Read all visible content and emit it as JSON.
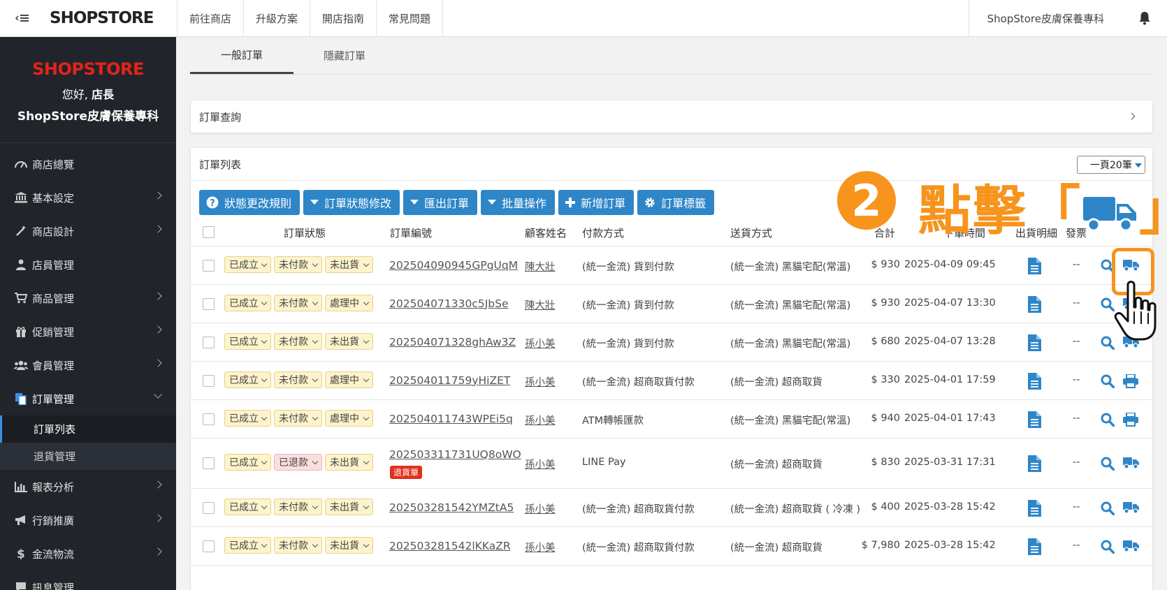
{
  "topbar": {
    "toggle_label": "‹ ≡",
    "logo": "SHOPSTORE",
    "nav": [
      "前往商店",
      "升級方案",
      "開店指南",
      "常見問題"
    ],
    "shop_name": "ShopStore皮膚保養專科"
  },
  "sidebar": {
    "logo": "SHOPSTORE",
    "greeting_prefix": "您好,",
    "greeting_role": "店長",
    "shop_name": "ShopStore皮膚保養專科",
    "items": [
      {
        "label": "商店總覽"
      },
      {
        "label": "基本設定"
      },
      {
        "label": "商店設計"
      },
      {
        "label": "店員管理"
      },
      {
        "label": "商品管理"
      },
      {
        "label": "促銷管理"
      },
      {
        "label": "會員管理"
      },
      {
        "label": "訂單管理"
      },
      {
        "label": "報表分析"
      },
      {
        "label": "行銷推廣"
      },
      {
        "label": "金流物流"
      },
      {
        "label": "訊息管理"
      }
    ],
    "sub_items": [
      "訂單列表",
      "退貨管理"
    ]
  },
  "tabs": [
    "一般訂單",
    "隱藏訂單"
  ],
  "query_panel": {
    "title": "訂單查詢"
  },
  "list_panel": {
    "title": "訂單列表",
    "per_page": "一頁20筆",
    "buttons": [
      "狀態更改規則",
      "訂單狀態修改",
      "匯出訂單",
      "批量操作",
      "新增訂單",
      "訂單標籤"
    ],
    "headers": [
      "訂單狀態",
      "訂單編號",
      "顧客姓名",
      "付款方式",
      "送貨方式",
      "合計",
      "下單時間",
      "出貨明細",
      "發票"
    ]
  },
  "orders": [
    {
      "status": [
        "已成立",
        "未付款",
        "未出貨"
      ],
      "order_no": "202504090945GPgUqM",
      "return_badge": "",
      "customer": "陳大壯",
      "payment": "(統一金流) 貨到付款",
      "shipping": "(統一金流) 黑貓宅配(常溫)",
      "total": "$ 930",
      "time": "2025-04-09 09:45",
      "invoice": "--",
      "action": "truck"
    },
    {
      "status": [
        "已成立",
        "未付款",
        "處理中"
      ],
      "order_no": "202504071330c5JbSe",
      "return_badge": "",
      "customer": "陳大壯",
      "payment": "(統一金流) 貨到付款",
      "shipping": "(統一金流) 黑貓宅配(常溫)",
      "total": "$ 930",
      "time": "2025-04-07 13:30",
      "invoice": "--",
      "action": "truck"
    },
    {
      "status": [
        "已成立",
        "未付款",
        "未出貨"
      ],
      "order_no": "202504071328ghAw3Z",
      "return_badge": "",
      "customer": "孫小美",
      "payment": "(統一金流) 貨到付款",
      "shipping": "(統一金流) 黑貓宅配(常溫)",
      "total": "$ 680",
      "time": "2025-04-07 13:28",
      "invoice": "--",
      "action": "truck"
    },
    {
      "status": [
        "已成立",
        "未付款",
        "處理中"
      ],
      "order_no": "202504011759yHiZET",
      "return_badge": "",
      "customer": "孫小美",
      "payment": "(統一金流) 超商取貨付款",
      "shipping": "(統一金流) 超商取貨",
      "total": "$ 330",
      "time": "2025-04-01 17:59",
      "invoice": "--",
      "action": "print"
    },
    {
      "status": [
        "已成立",
        "未付款",
        "處理中"
      ],
      "order_no": "202504011743WPEi5q",
      "return_badge": "",
      "customer": "孫小美",
      "payment": "ATM轉帳匯款",
      "shipping": "(統一金流) 黑貓宅配(常溫)",
      "total": "$ 940",
      "time": "2025-04-01 17:43",
      "invoice": "--",
      "action": "print"
    },
    {
      "status": [
        "已成立",
        "已退款",
        "未出貨"
      ],
      "order_no": "202503311731UQ8oWO",
      "return_badge": "退貨單",
      "customer": "孫小美",
      "payment": "LINE Pay",
      "shipping": "(統一金流) 超商取貨",
      "total": "$ 830",
      "time": "2025-03-31 17:31",
      "invoice": "--",
      "action": "truck"
    },
    {
      "status": [
        "已成立",
        "未付款",
        "未出貨"
      ],
      "order_no": "202503281542YMZtA5",
      "return_badge": "",
      "customer": "孫小美",
      "payment": "(統一金流) 超商取貨付款",
      "shipping": "(統一金流) 超商取貨 ( 冷凍 )",
      "total": "$ 400",
      "time": "2025-03-28 15:42",
      "invoice": "--",
      "action": "truck"
    },
    {
      "status": [
        "已成立",
        "未付款",
        "未出貨"
      ],
      "order_no": "202503281542lKKaZR",
      "return_badge": "",
      "customer": "孫小美",
      "payment": "(統一金流) 超商取貨付款",
      "shipping": "(統一金流) 超商取貨",
      "total": "$ 7,980",
      "time": "2025-03-28 15:42",
      "invoice": "--",
      "action": "truck"
    }
  ],
  "annotation": {
    "step": "2",
    "text": "點擊「",
    "text_end": "」"
  },
  "colors": {
    "primary": "#2e86c8",
    "annotation": "#f7941d",
    "sidebar_bg": "#21252b",
    "brand_red": "#e52218"
  }
}
